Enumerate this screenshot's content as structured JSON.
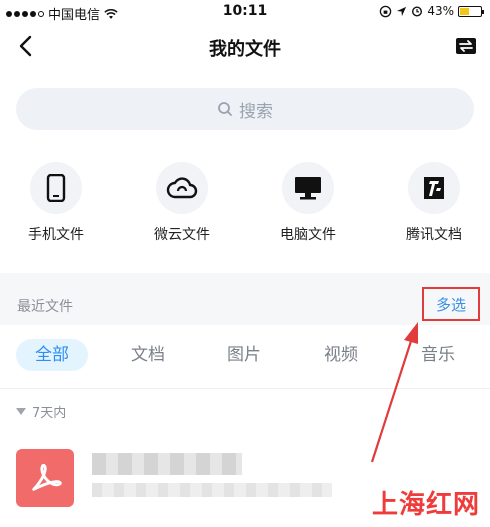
{
  "status_bar": {
    "carrier": "中国电信",
    "time": "10:11",
    "battery": "43%",
    "battery_level": 0.43
  },
  "nav": {
    "title": "我的文件"
  },
  "search": {
    "placeholder": "搜索"
  },
  "quick_entries": [
    {
      "label": "手机文件",
      "icon": "phone-icon"
    },
    {
      "label": "微云文件",
      "icon": "cloud-icon"
    },
    {
      "label": "电脑文件",
      "icon": "monitor-icon"
    },
    {
      "label": "腾讯文档",
      "icon": "tencent-docs-icon"
    }
  ],
  "recent": {
    "title": "最近文件",
    "multi_select": "多选"
  },
  "tabs": [
    "全部",
    "文档",
    "图片",
    "视频",
    "音乐"
  ],
  "group": {
    "label": "7天内"
  },
  "watermark": "上海红网",
  "colors": {
    "accent": "#2b8df5",
    "highlight_box": "#e23b3b",
    "pdf_icon": "#f16b6b"
  }
}
